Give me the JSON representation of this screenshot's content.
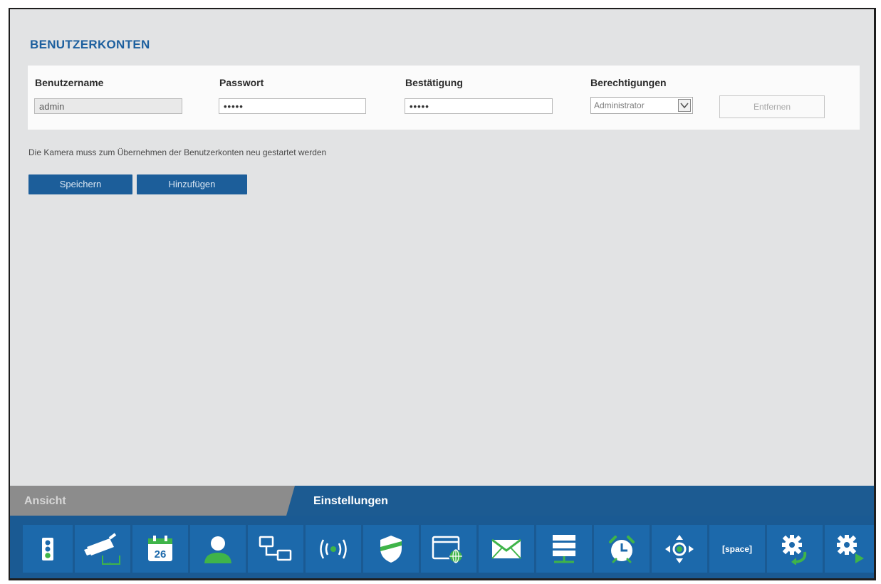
{
  "section": {
    "title": "BENUTZERKONTEN"
  },
  "table": {
    "headers": [
      "Benutzername",
      "Passwort",
      "Bestätigung",
      "Berechtigungen"
    ],
    "row": {
      "username": "admin",
      "password": "•••••",
      "confirm": "•••••",
      "permission": "Administrator",
      "remove_label": "Entfernen"
    }
  },
  "note": "Die Kamera muss zum Übernehmen der Benutzerkonten neu gestartet werden",
  "buttons": {
    "save": "Speichern",
    "add": "Hinzufügen"
  },
  "tabs": {
    "view": "Ansicht",
    "settings": "Einstellungen"
  },
  "toolbar": {
    "calendar_day": "26",
    "space_label": "[space]",
    "icons": [
      "status-icon",
      "camera-icon",
      "calendar-icon",
      "user-icon",
      "network-icon",
      "wireless-icon",
      "security-icon",
      "web-icon",
      "mail-icon",
      "storage-icon",
      "alarm-clock-icon",
      "ptz-icon",
      "space-icon",
      "settings-refresh-icon",
      "settings-play-icon"
    ]
  },
  "colors": {
    "accent": "#1c5f9e",
    "toolbar": "#1a5a93",
    "tab_inactive": "#8c8c8c",
    "icon_green": "#3fb449"
  }
}
